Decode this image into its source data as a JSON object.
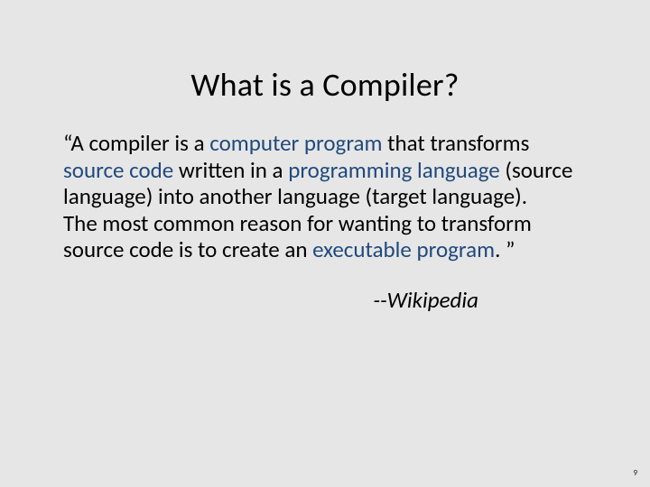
{
  "title": "What is a Compiler?",
  "body": {
    "q_open": "“A compiler is a ",
    "link_compprog": "computer program",
    "t_that": " that transforms ",
    "link_source": "source code",
    "t_written": " written in a ",
    "link_proglang": "programming language",
    "t_srcinto": " (source language) into another language (target language).",
    "p2_a": "The most common reason for wanting to transform source code is to create an ",
    "link_exec": "executable program",
    "p2_b": ". ”"
  },
  "attribution": "--Wikipedia",
  "page_number": "9"
}
